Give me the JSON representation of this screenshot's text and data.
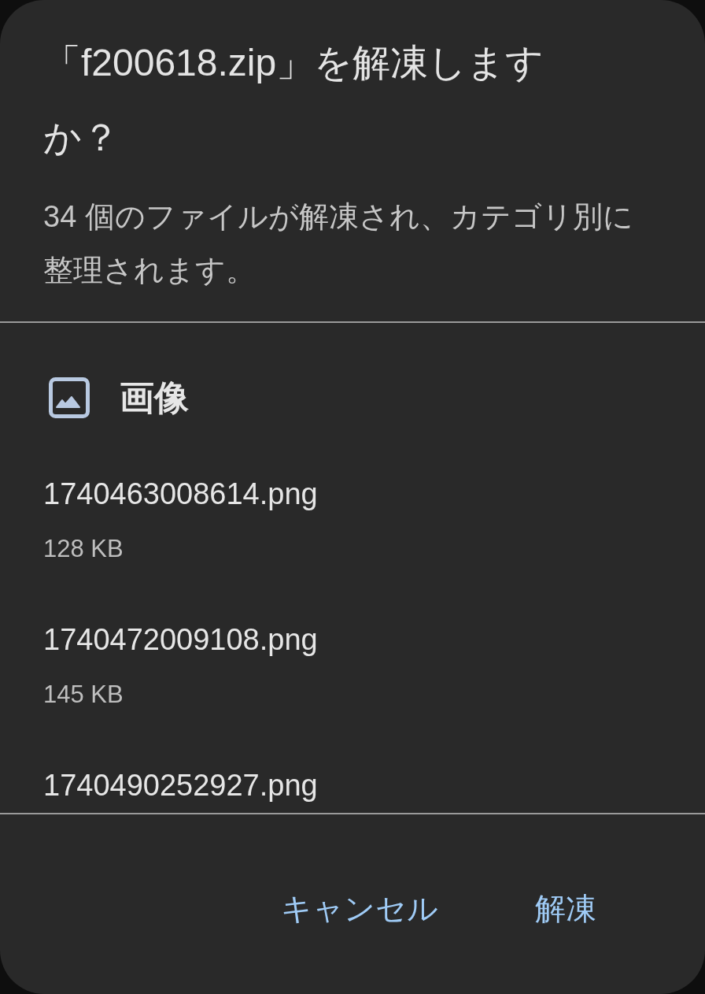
{
  "dialog": {
    "title": "「f200618.zip」を解凍しますか？",
    "message": "34 個のファイルが解凍され、カテゴリ別に整理されます。"
  },
  "sections": [
    {
      "label": "画像",
      "kind": "image",
      "files": [
        {
          "name": "1740463008614.png",
          "size": "128 KB"
        },
        {
          "name": "1740472009108.png",
          "size": "145 KB"
        },
        {
          "name": "1740490252927.png"
        }
      ]
    }
  ],
  "buttons": [
    {
      "label": "キャンセル"
    },
    {
      "label": "解凍"
    }
  ]
}
